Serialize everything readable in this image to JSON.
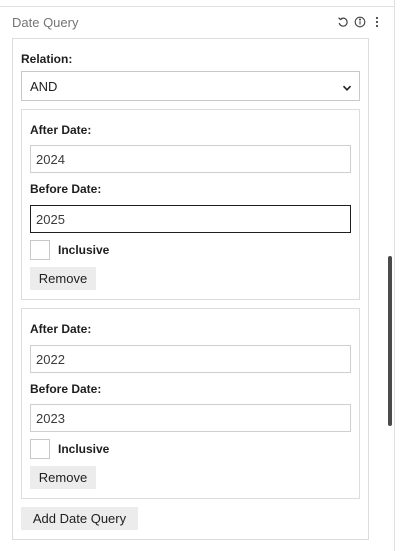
{
  "panel": {
    "title": "Date Query",
    "icons": [
      "undo-icon",
      "info-icon",
      "more-vertical-icon"
    ]
  },
  "relation": {
    "label": "Relation:",
    "selected": "AND"
  },
  "date_queries": [
    {
      "after_label": "After Date:",
      "after_value": "2024",
      "before_label": "Before Date:",
      "before_value": "2025",
      "inclusive_label": "Inclusive",
      "inclusive_checked": false,
      "remove_label": "Remove"
    },
    {
      "after_label": "After Date:",
      "after_value": "2022",
      "before_label": "Before Date:",
      "before_value": "2023",
      "inclusive_label": "Inclusive",
      "inclusive_checked": false,
      "remove_label": "Remove"
    }
  ],
  "add_button": "Add Date Query"
}
